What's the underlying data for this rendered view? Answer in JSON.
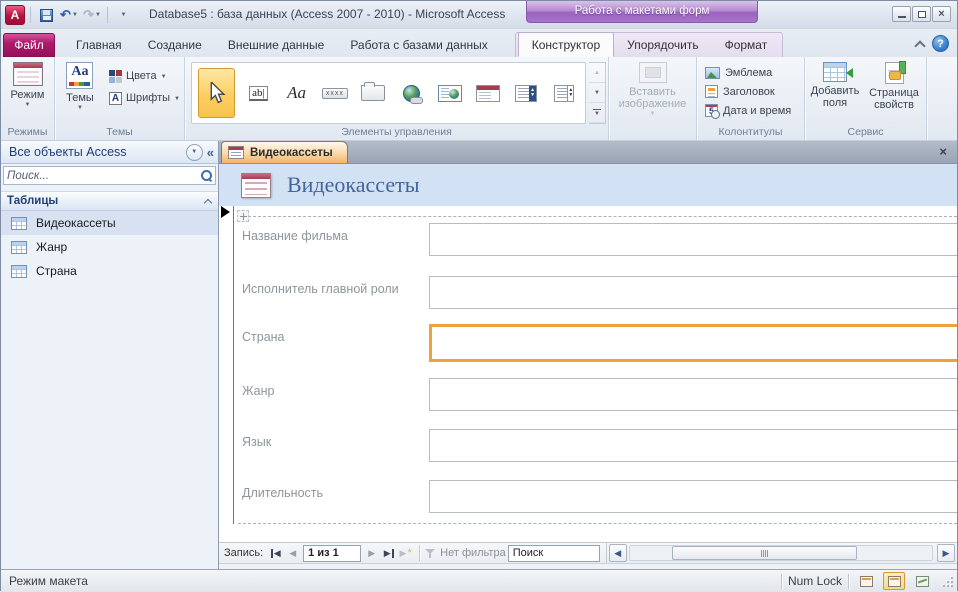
{
  "window": {
    "title": "Database5 : база данных (Access 2007 - 2010)  -  Microsoft Access",
    "contextual_header": "Работа с макетами форм"
  },
  "glyphs": {
    "dropdown": "▼",
    "undo": "↶",
    "redo": "↷",
    "help": "?",
    "close": "×",
    "pane_collapse": "«",
    "left": "◀",
    "right": "▶",
    "up": "▲",
    "down": "▼",
    "star": "*",
    "aa": "Aa",
    "ab": "ab|",
    "xxxx": "xxxx",
    "a": "A",
    "five": "5"
  },
  "tabs": {
    "file": "Файл",
    "main": [
      "Главная",
      "Создание",
      "Внешние данные",
      "Работа с базами данных"
    ],
    "contextual": [
      "Конструктор",
      "Упорядочить",
      "Формат"
    ],
    "active_tab": "Конструктор"
  },
  "ribbon": {
    "views_group": {
      "label": "Режимы",
      "mode_button": "Режим"
    },
    "themes_group": {
      "label": "Темы",
      "themes_button": "Темы",
      "colors_button": "Цвета",
      "fonts_button": "Шрифты"
    },
    "controls_group": {
      "label": "Элементы управления"
    },
    "insert_image_button": "Вставить изображение",
    "header_group": {
      "label": "Колонтитулы",
      "logo": "Эмблема",
      "title": "Заголовок",
      "datetime": "Дата и время"
    },
    "tools_group": {
      "label": "Сервис",
      "add_fields": "Добавить поля",
      "property_sheet": "Страница свойств"
    }
  },
  "nav_pane": {
    "header": "Все объекты Access",
    "search_placeholder": "Поиск...",
    "section_header": "Таблицы",
    "items": [
      {
        "label": "Видеокассеты",
        "selected": true
      },
      {
        "label": "Жанр",
        "selected": false
      },
      {
        "label": "Страна",
        "selected": false
      }
    ]
  },
  "document": {
    "tab_label": "Видеокассеты",
    "form_title": "Видеокассеты",
    "fields": [
      {
        "label": "Название фильма",
        "selected": false
      },
      {
        "label": "Исполнитель главной роли",
        "selected": false
      },
      {
        "label": "Страна",
        "selected": true
      },
      {
        "label": "Жанр",
        "selected": false
      },
      {
        "label": "Язык",
        "selected": false
      },
      {
        "label": "Длительность",
        "selected": false
      }
    ],
    "selection_color": "#EFA23C"
  },
  "record_nav": {
    "label": "Запись:",
    "counter": "1 из 1",
    "no_filter": "Нет фильтра",
    "search_value": "Поиск"
  },
  "status_bar": {
    "view_mode": "Режим макета",
    "num_lock": "Num Lock"
  },
  "colors": {
    "contextual_purple": "#9A63C0",
    "file_tab_magenta": "#B01A6C",
    "doc_tab_orange": "#F0B468",
    "form_header_blue": "#D3E1F4"
  }
}
